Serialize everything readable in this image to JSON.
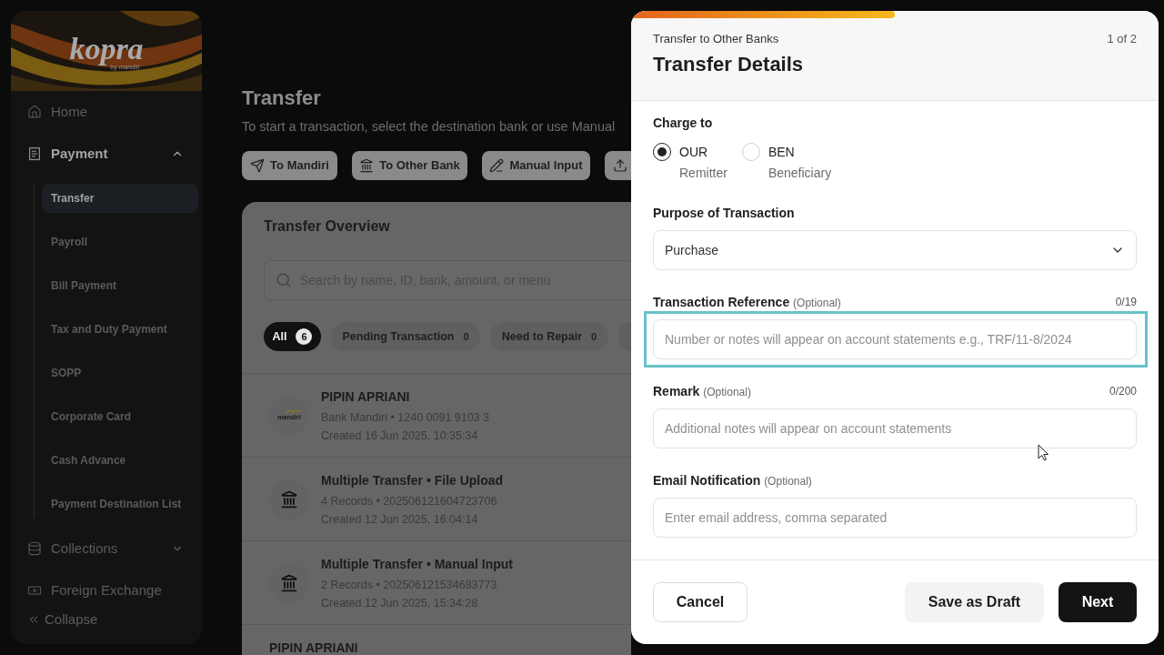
{
  "sidebar": {
    "logo": {
      "name": "kopra",
      "tagline": "by mandiri"
    },
    "items": [
      {
        "label": "Home",
        "kind": "link",
        "selected": false
      },
      {
        "label": "Payment",
        "kind": "group",
        "selected": true,
        "expanded": true,
        "children": [
          {
            "label": "Transfer",
            "selected": true
          },
          {
            "label": "Payroll",
            "selected": false
          },
          {
            "label": "Bill Payment",
            "selected": false
          },
          {
            "label": "Tax and Duty Payment",
            "selected": false
          },
          {
            "label": "SOPP",
            "selected": false
          },
          {
            "label": "Corporate Card",
            "selected": false
          },
          {
            "label": "Cash Advance",
            "selected": false
          },
          {
            "label": "Payment Destination List",
            "selected": false
          }
        ]
      },
      {
        "label": "Collections",
        "kind": "group",
        "selected": false,
        "expanded": false
      },
      {
        "label": "Foreign Exchange",
        "kind": "link",
        "selected": false
      }
    ],
    "collapse": "Collapse"
  },
  "page": {
    "title": "Transfer",
    "subtitle": "To start a transaction, select the destination bank or use Manual",
    "actions": [
      {
        "label": "To Mandiri"
      },
      {
        "label": "To Other Bank"
      },
      {
        "label": "Manual Input"
      }
    ]
  },
  "overview": {
    "title": "Transfer Overview",
    "search": {
      "placeholder": "Search by name, ID, bank, amount, or menu"
    },
    "filters": [
      {
        "label": "All",
        "count": "6",
        "selected": true
      },
      {
        "label": "Pending Transaction",
        "count": "0",
        "selected": false
      },
      {
        "label": "Need to Repair",
        "count": "0",
        "selected": false
      }
    ],
    "rows": [
      {
        "kind": "mandiri",
        "logo_text": "mandiri",
        "title": "PIPIN APRIANI",
        "details": "Bank Mandiri • 1240 0091 9103 3",
        "created": "Created 16 Jun 2025, 10:35:34"
      },
      {
        "kind": "bank",
        "title": "Multiple Transfer • File Upload",
        "details": "4 Records • 202506121604723706",
        "created": "Created 12 Jun 2025, 16:04:14"
      },
      {
        "kind": "bank",
        "title": "Multiple Transfer • Manual Input",
        "details": "2 Records • 202506121534683773",
        "created": "Created 12 Jun 2025, 15:34:28"
      },
      {
        "title": "PIPIN APRIANI"
      }
    ]
  },
  "modal": {
    "progress": {
      "level": 0.5
    },
    "subtitle": "Transfer to Other Banks",
    "step": "1 of 2",
    "title": "Transfer Details",
    "charge": {
      "label": "Charge to",
      "options": [
        {
          "code": "OUR",
          "description": "Remitter",
          "selected": true
        },
        {
          "code": "BEN",
          "description": "Beneficiary",
          "selected": false
        }
      ]
    },
    "purpose": {
      "label": "Purpose of Transaction",
      "value": "Purchase"
    },
    "fields": [
      {
        "label": "Transaction Reference",
        "note": "(Optional)",
        "counter": "0/19",
        "placeholder": "Number or notes will appear on account statements e.g., TRF/11-8/2024",
        "focused": true
      },
      {
        "label": "Remark",
        "note": "(Optional)",
        "counter": "0/200",
        "placeholder": "Additional notes will appear on account statements",
        "focused": false
      },
      {
        "label": "Email Notification",
        "note": "(Optional)",
        "placeholder": "Enter email address, comma separated",
        "focused": false
      }
    ],
    "buttons": [
      {
        "label": "Cancel",
        "kind": "outline"
      },
      {
        "label": "Save as Draft",
        "kind": "secondary"
      },
      {
        "label": "Next",
        "kind": "primary"
      }
    ]
  }
}
